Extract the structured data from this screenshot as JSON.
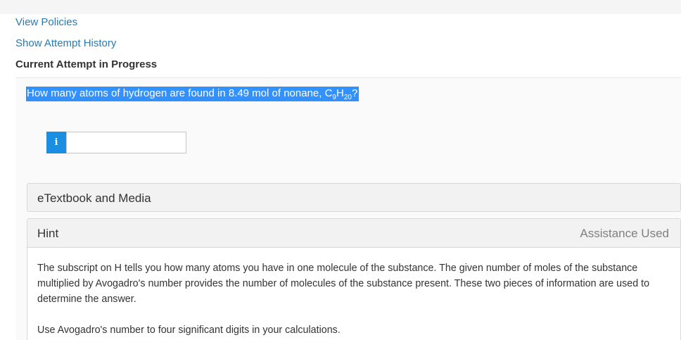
{
  "links": {
    "view_policies": "View Policies",
    "attempt_history": "Show Attempt History"
  },
  "attempt": {
    "title": "Current Attempt in Progress"
  },
  "question": {
    "prefix": "How many atoms of hydrogen are found in 8.49 mol of nonane, C",
    "c_subscript": "9",
    "h_letter": "H",
    "h_subscript": "20",
    "suffix": "?"
  },
  "answer": {
    "info_icon_glyph": "i",
    "value": ""
  },
  "etextbook": {
    "label": "eTextbook and Media"
  },
  "hint": {
    "title": "Hint",
    "assistance": "Assistance Used",
    "paragraph1": "The subscript on H tells you how many atoms you have in one molecule of the substance. The given number of moles of the substance multiplied by Avogadro's number provides the number of molecules of the substance present. These two pieces of information are used to determine the answer.",
    "paragraph2": "Use Avogadro's number to four significant digits in your calculations."
  },
  "colors": {
    "link": "#2a7ab0",
    "selection": "#3390ff",
    "info_button": "#1a8ee1"
  }
}
